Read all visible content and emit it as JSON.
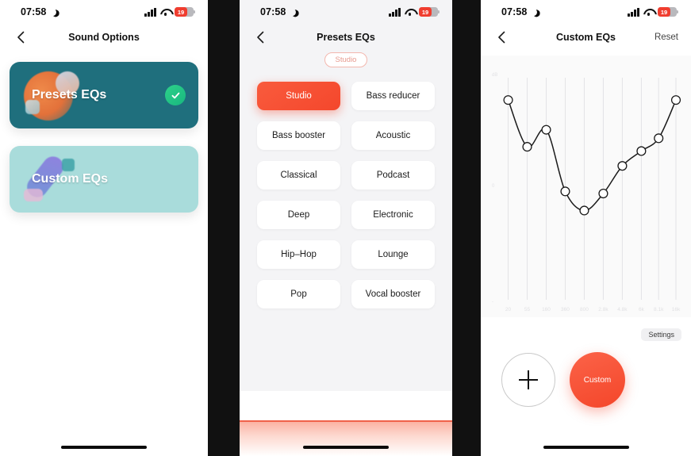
{
  "statusbar": {
    "time": "07:58",
    "moon_icon": "moon-icon",
    "signal_icon": "signal-bars-icon",
    "wifi_icon": "wifi-icon",
    "battery_icon": "battery-icon",
    "battery_level": "19"
  },
  "panel1": {
    "nav": {
      "back_icon": "chevron-left-icon",
      "title": "Sound Options"
    },
    "cards": [
      {
        "label": "Presets EQs",
        "selected": true,
        "check_icon": "check-circle-icon",
        "bg": "#1f6f7d"
      },
      {
        "label": "Custom EQs",
        "selected": false,
        "bg": "#a9dcdb"
      }
    ]
  },
  "panel2": {
    "nav": {
      "back_icon": "chevron-left-icon",
      "title": "Presets EQs"
    },
    "badge": "Studio",
    "presets": [
      {
        "label": "Studio",
        "active": true
      },
      {
        "label": "Bass reducer",
        "active": false
      },
      {
        "label": "Bass booster",
        "active": false
      },
      {
        "label": "Acoustic",
        "active": false
      },
      {
        "label": "Classical",
        "active": false
      },
      {
        "label": "Podcast",
        "active": false
      },
      {
        "label": "Deep",
        "active": false
      },
      {
        "label": "Electronic",
        "active": false
      },
      {
        "label": "Hip–Hop",
        "active": false
      },
      {
        "label": "Lounge",
        "active": false
      },
      {
        "label": "Pop",
        "active": false
      },
      {
        "label": "Vocal booster",
        "active": false
      }
    ]
  },
  "panel3": {
    "nav": {
      "back_icon": "chevron-left-icon",
      "title": "Custom EQs",
      "reset_label": "Reset"
    },
    "settings_label": "Settings",
    "add_icon": "plus-icon",
    "custom_label": "Custom",
    "chart_data": {
      "type": "line",
      "title": "Custom EQs",
      "xlabel": "",
      "ylabel": "dB",
      "categories": [
        "20",
        "55",
        "160",
        "360",
        "800",
        "2.8k",
        "4.8k",
        "6k",
        "8.1k",
        "16k"
      ],
      "tick_labels": [
        "20",
        "55",
        "160",
        "360",
        "800",
        "2.8k",
        "4.8k",
        "6k",
        "8.1k",
        "16k"
      ],
      "y_ticks": [
        "dB",
        "0",
        "-"
      ],
      "ylim": [
        -12,
        12
      ],
      "grid": true,
      "legend": "none",
      "series": [
        {
          "name": "Custom",
          "x": [
            20,
            55,
            160,
            360,
            800,
            2800,
            4800,
            6000,
            8100,
            16000
          ],
          "values": [
            11.0,
            4.5,
            7.0,
            -1.0,
            -3.4,
            -1.2,
            2.5,
            5.0,
            6.6,
            11.0
          ]
        }
      ],
      "points": [
        {
          "x_pct": 3,
          "y_pct": 9
        },
        {
          "x_pct": 14,
          "y_pct": 31
        },
        {
          "x_pct": 25,
          "y_pct": 23
        },
        {
          "x_pct": 36,
          "y_pct": 52
        },
        {
          "x_pct": 47,
          "y_pct": 61
        },
        {
          "x_pct": 58,
          "y_pct": 53
        },
        {
          "x_pct": 69,
          "y_pct": 40
        },
        {
          "x_pct": 80,
          "y_pct": 33
        },
        {
          "x_pct": 90,
          "y_pct": 27
        },
        {
          "x_pct": 100,
          "y_pct": 9
        }
      ]
    }
  },
  "colors": {
    "accent_red": "#f4472c",
    "teal_dark": "#1f6f7d",
    "teal_light": "#a9dcdb",
    "green_check": "#18b87f",
    "battery_red": "#f03d2f"
  }
}
